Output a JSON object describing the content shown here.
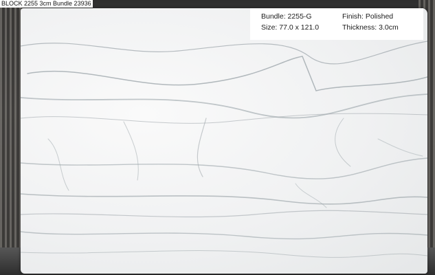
{
  "caption": "BLOCK 2255 3cm Bundle 23936",
  "info": {
    "bundle_label": "Bundle:",
    "bundle_value": "2255-G",
    "finish_label": "Finish:",
    "finish_value": "Polished",
    "size_label": "Size:",
    "size_value": "77.0 x 121.0",
    "thickness_label": "Thickness:",
    "thickness_value": "3.0cm"
  }
}
